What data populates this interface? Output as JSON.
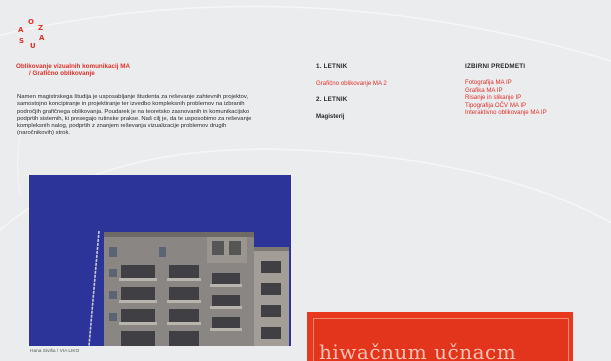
{
  "logo": {
    "letters": [
      "O",
      "Z",
      "A",
      "U",
      "S",
      "A"
    ]
  },
  "program": {
    "title_line1": "Oblikovanje vizualnih komunikacij MA",
    "title_line2": "/ Grafično oblikovanje"
  },
  "description": "Namen magistrskega študija je usposabljanje študenta za reševanje zahtevnih projektov, samostojno koncipiranje in projektiranje ter izvedbo kompleksnih problemov na izbranih področjih grafičnega oblikovanja. Poudarek je na teoretsko zasnovanih in komunikacijsko podprtih sistemih, ki presegajo rutinske prakse. Naš cilj je, da te usposobimo za reševanje kompleksnih nalog, podprtih z znanjem reševanja vizualizacije problemov drugih (naročnikovih) strok.",
  "years": {
    "first_heading": "1. LETNIK",
    "first_link": "Grafično oblikovanje MA 2",
    "second_heading": "2. LETNIK",
    "thesis_link": "Magisterij"
  },
  "electives": {
    "heading": "IZBIRNI PREDMETI",
    "items": [
      "Fotografija MA IP",
      "Grafika MA IP",
      "Risanje in slikanje IP",
      "Tipografija OČV MA IP",
      "Interaktivno oblikovanje MA IP"
    ]
  },
  "photo": {
    "credit": "Hana Siviša / VIA LIKO"
  },
  "card": {
    "text": "hiwačnum učnacm"
  },
  "colors": {
    "accent": "#e0312a",
    "photo_bg": "#2c3499",
    "card_bg": "#e8391f"
  }
}
